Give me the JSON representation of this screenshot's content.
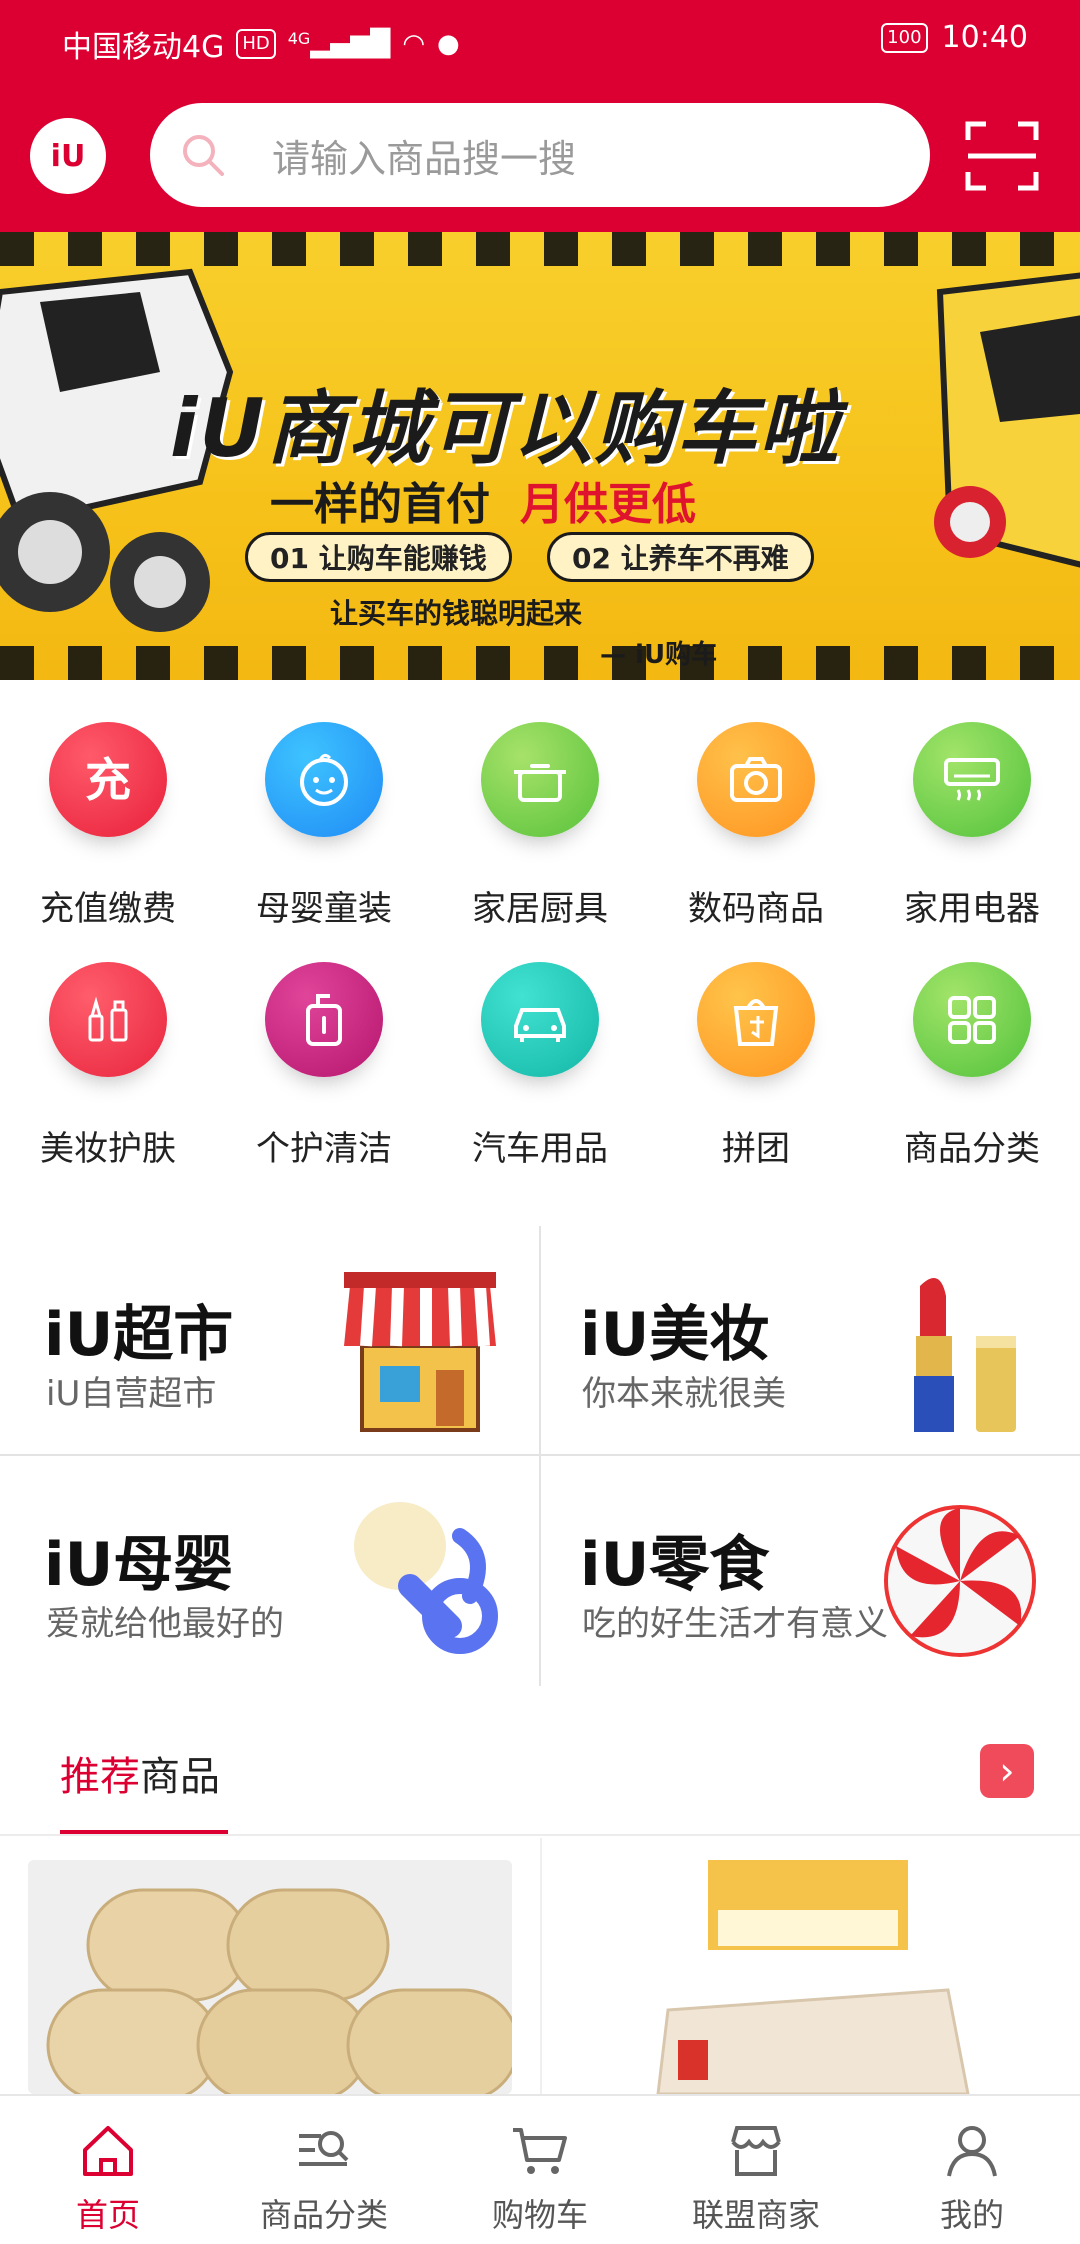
{
  "status_bar": {
    "carrier": "中国移动4G",
    "hd": "HD",
    "network": "4G",
    "battery": "100",
    "time": "10:40"
  },
  "header": {
    "logo_text": "iU",
    "search_placeholder": "请输入商品搜一搜"
  },
  "banner": {
    "title": "iU商城可以购车啦",
    "subtitle_a": "一样的首付",
    "subtitle_b": "月供更低",
    "pill_1": "01 让购车能赚钱",
    "pill_2": "02 让养车不再难",
    "slogan": "让买车的钱聪明起来",
    "signature": "— iU购车"
  },
  "categories": [
    {
      "label": "充值缴费",
      "icon": "charge-icon",
      "color_a": "#ff5a6a",
      "color_b": "#e8203a"
    },
    {
      "label": "母婴童装",
      "icon": "baby-icon",
      "color_a": "#3ec3ff",
      "color_b": "#1f8bf5"
    },
    {
      "label": "家居厨具",
      "icon": "pot-icon",
      "color_a": "#a7e26a",
      "color_b": "#58c23a"
    },
    {
      "label": "数码商品",
      "icon": "camera-icon",
      "color_a": "#ffc14a",
      "color_b": "#ff9320"
    },
    {
      "label": "家用电器",
      "icon": "air-conditioner-icon",
      "color_a": "#a2e46a",
      "color_b": "#52c23b"
    },
    {
      "label": "美妆护肤",
      "icon": "makeup-icon",
      "color_a": "#ff5d6b",
      "color_b": "#e8253e"
    },
    {
      "label": "个护清洁",
      "icon": "toiletry-icon",
      "color_a": "#e0459a",
      "color_b": "#b6166e"
    },
    {
      "label": "汽车用品",
      "icon": "car-icon",
      "color_a": "#42e2d2",
      "color_b": "#13b6a6"
    },
    {
      "label": "拼团",
      "icon": "shopping-bag-icon",
      "color_a": "#ffc44b",
      "color_b": "#ff9520"
    },
    {
      "label": "商品分类",
      "icon": "grid-icon",
      "color_a": "#a2e46a",
      "color_b": "#52c23b"
    }
  ],
  "promos": [
    {
      "title": "iU超市",
      "subtitle": "iU自营超市"
    },
    {
      "title": "iU美妆",
      "subtitle": "你本来就很美"
    },
    {
      "title": "iU母婴",
      "subtitle": "爱就给他最好的"
    },
    {
      "title": "iU零食",
      "subtitle": "吃的好生活才有意义"
    }
  ],
  "recommend": {
    "title_red": "推荐",
    "title_rest": "商品",
    "more": "›"
  },
  "bottom_nav": [
    {
      "label": "首页",
      "icon": "home-icon",
      "active": true
    },
    {
      "label": "商品分类",
      "icon": "category-search-icon",
      "active": false
    },
    {
      "label": "购物车",
      "icon": "cart-icon",
      "active": false
    },
    {
      "label": "联盟商家",
      "icon": "store-icon",
      "active": false
    },
    {
      "label": "我的",
      "icon": "user-icon",
      "active": false
    }
  ],
  "colors": {
    "brand": "#dc0032"
  }
}
